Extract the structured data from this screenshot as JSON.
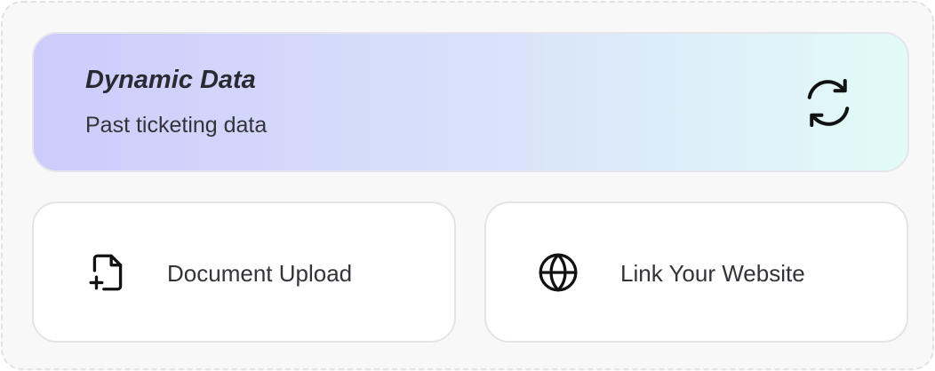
{
  "hero": {
    "title": "Dynamic Data",
    "subtitle": "Past ticketing data",
    "icon": "refresh-icon",
    "gradient": [
      "#cdcbfb",
      "#d8e1fb",
      "#e2fbf7"
    ]
  },
  "options": [
    {
      "label": "Document Upload",
      "icon": "file-plus-icon"
    },
    {
      "label": "Link Your Website",
      "icon": "globe-icon"
    }
  ],
  "colors": {
    "text": "#33333a",
    "card_border": "#e4e4e4",
    "panel_background": "#f8f8f8"
  }
}
